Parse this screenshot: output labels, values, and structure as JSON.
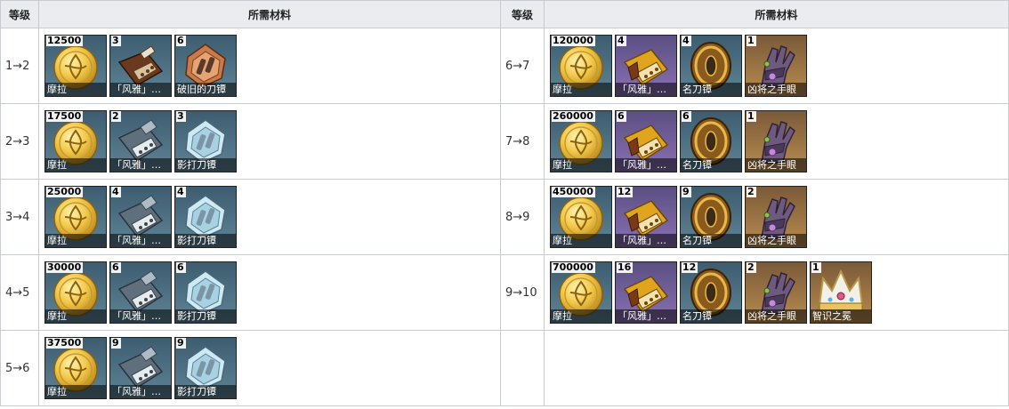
{
  "headers": {
    "level": "等级",
    "materials": "所需材料"
  },
  "rows": [
    {
      "left": {
        "level": "1→2",
        "items": [
          {
            "icon": "mora",
            "bg": "blue",
            "count": "12500",
            "name": "摩拉"
          },
          {
            "icon": "guard-brown",
            "bg": "blue",
            "count": "3",
            "name": "「风雅」…"
          },
          {
            "icon": "tsuba-old",
            "bg": "blue",
            "count": "6",
            "name": "破旧的刀镡"
          }
        ]
      },
      "right": {
        "level": "6→7",
        "items": [
          {
            "icon": "mora",
            "bg": "blue",
            "count": "120000",
            "name": "摩拉"
          },
          {
            "icon": "guard-gold",
            "bg": "purple",
            "count": "4",
            "name": "「风雅」…"
          },
          {
            "icon": "tsuba-gold",
            "bg": "blue",
            "count": "4",
            "name": "名刀镡"
          },
          {
            "icon": "gauntlet",
            "bg": "gold",
            "count": "1",
            "name": "凶将之手眼"
          }
        ]
      }
    },
    {
      "left": {
        "level": "2→3",
        "items": [
          {
            "icon": "mora",
            "bg": "blue",
            "count": "17500",
            "name": "摩拉"
          },
          {
            "icon": "guard-silver",
            "bg": "blue",
            "count": "2",
            "name": "「风雅」…"
          },
          {
            "icon": "tsuba-silver",
            "bg": "blue",
            "count": "3",
            "name": "影打刀镡"
          }
        ]
      },
      "right": {
        "level": "7→8",
        "items": [
          {
            "icon": "mora",
            "bg": "blue",
            "count": "260000",
            "name": "摩拉"
          },
          {
            "icon": "guard-gold",
            "bg": "purple",
            "count": "6",
            "name": "「风雅」…"
          },
          {
            "icon": "tsuba-gold",
            "bg": "blue",
            "count": "6",
            "name": "名刀镡"
          },
          {
            "icon": "gauntlet",
            "bg": "gold",
            "count": "1",
            "name": "凶将之手眼"
          }
        ]
      }
    },
    {
      "left": {
        "level": "3→4",
        "items": [
          {
            "icon": "mora",
            "bg": "blue",
            "count": "25000",
            "name": "摩拉"
          },
          {
            "icon": "guard-silver",
            "bg": "blue",
            "count": "4",
            "name": "「风雅」…"
          },
          {
            "icon": "tsuba-silver",
            "bg": "blue",
            "count": "4",
            "name": "影打刀镡"
          }
        ]
      },
      "right": {
        "level": "8→9",
        "items": [
          {
            "icon": "mora",
            "bg": "blue",
            "count": "450000",
            "name": "摩拉"
          },
          {
            "icon": "guard-gold",
            "bg": "purple",
            "count": "12",
            "name": "「风雅」…"
          },
          {
            "icon": "tsuba-gold",
            "bg": "blue",
            "count": "9",
            "name": "名刀镡"
          },
          {
            "icon": "gauntlet",
            "bg": "gold",
            "count": "2",
            "name": "凶将之手眼"
          }
        ]
      }
    },
    {
      "left": {
        "level": "4→5",
        "items": [
          {
            "icon": "mora",
            "bg": "blue",
            "count": "30000",
            "name": "摩拉"
          },
          {
            "icon": "guard-silver",
            "bg": "blue",
            "count": "6",
            "name": "「风雅」…"
          },
          {
            "icon": "tsuba-silver",
            "bg": "blue",
            "count": "6",
            "name": "影打刀镡"
          }
        ]
      },
      "right": {
        "level": "9→10",
        "items": [
          {
            "icon": "mora",
            "bg": "blue",
            "count": "700000",
            "name": "摩拉"
          },
          {
            "icon": "guard-gold",
            "bg": "purple",
            "count": "16",
            "name": "「风雅」…"
          },
          {
            "icon": "tsuba-gold",
            "bg": "blue",
            "count": "12",
            "name": "名刀镡"
          },
          {
            "icon": "gauntlet",
            "bg": "gold",
            "count": "2",
            "name": "凶将之手眼"
          },
          {
            "icon": "crown",
            "bg": "gold",
            "count": "1",
            "name": "智识之冕"
          }
        ]
      }
    },
    {
      "left": {
        "level": "5→6",
        "items": [
          {
            "icon": "mora",
            "bg": "blue",
            "count": "37500",
            "name": "摩拉"
          },
          {
            "icon": "guard-silver",
            "bg": "blue",
            "count": "9",
            "name": "「风雅」…"
          },
          {
            "icon": "tsuba-silver",
            "bg": "blue",
            "count": "9",
            "name": "影打刀镡"
          }
        ]
      },
      "right": null
    }
  ]
}
